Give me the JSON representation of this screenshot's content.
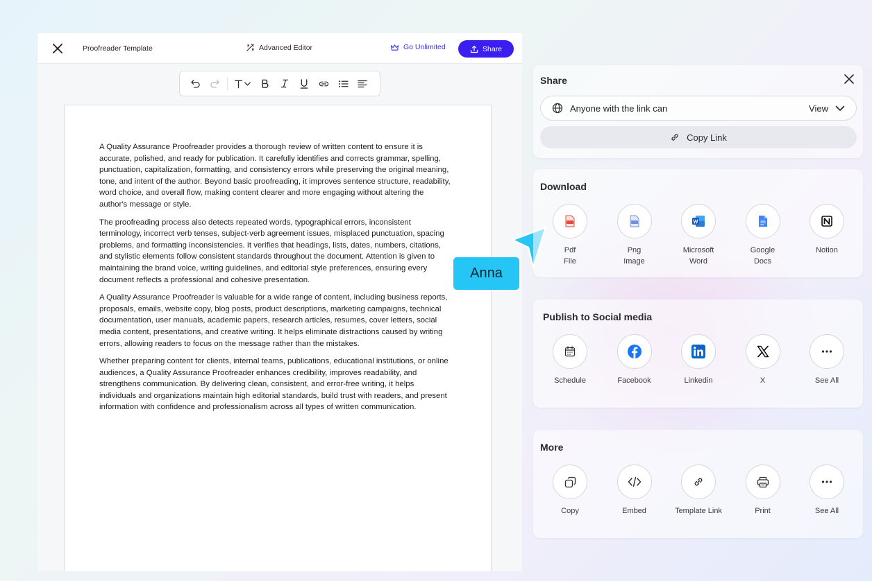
{
  "editor": {
    "title": "Proofreader Template",
    "advanced_editor_label": "Advanced Editor",
    "go_unlimited_label": "Go Unlimited",
    "share_label": "Share",
    "paragraphs": [
      "A Quality Assurance Proofreader provides a thorough review of written content to ensure it is accurate, polished, and ready for publication. It carefully identifies and corrects grammar, spelling, punctuation, capitalization, formatting, and consistency errors while preserving the original meaning, tone, and intent of the author. Beyond basic proofreading, it improves sentence structure, readability, word choice, and overall flow, making content clearer and more engaging without altering the author's message or style.",
      "The proofreading process also detects repeated words, typographical errors, inconsistent terminology, incorrect verb tenses, subject-verb agreement issues, misplaced punctuation, spacing problems, and formatting inconsistencies. It verifies that headings, lists, dates, numbers, citations, and stylistic elements follow consistent standards throughout the document. Attention is given to maintaining the brand voice, writing guidelines, and editorial style preferences, ensuring every document reflects a professional and cohesive presentation.",
      "A Quality Assurance Proofreader is valuable for a wide range of content, including business reports, proposals, emails, website copy, blog posts, product descriptions, marketing campaigns, technical documentation, user manuals, academic papers, research articles, resumes, cover letters, social media content, presentations, and creative writing. It helps eliminate distractions caused by writing errors, allowing readers to focus on the message rather than the mistakes.",
      "Whether preparing content for clients, internal teams, publications, educational institutions, or online audiences, a Quality Assurance Proofreader enhances credibility, improves readability, and strengthens communication. By delivering clean, consistent, and error-free writing, it helps individuals and organizations maintain high editorial standards, build trust with readers, and present information with confidence and professionalism across all types of written communication."
    ]
  },
  "cursor": {
    "name": "Anna",
    "color": "#25c6f5"
  },
  "share_panel": {
    "title": "Share",
    "access_label": "Anyone with the link can",
    "access_value": "View",
    "copy_link_label": "Copy Link"
  },
  "download_panel": {
    "title": "Download",
    "items": [
      {
        "line1": "Pdf",
        "line2": "File",
        "icon": "pdf-file-icon"
      },
      {
        "line1": "Png",
        "line2": "Image",
        "icon": "png-image-icon"
      },
      {
        "line1": "Microsoft",
        "line2": "Word",
        "icon": "microsoft-word-icon"
      },
      {
        "line1": "Google",
        "line2": "Docs",
        "icon": "google-docs-icon"
      },
      {
        "line1": "Notion",
        "line2": "",
        "icon": "notion-icon"
      }
    ]
  },
  "social_panel": {
    "title": "Publish to Social media",
    "items": [
      {
        "label": "Schedule",
        "icon": "calendar-icon"
      },
      {
        "label": "Facebook",
        "icon": "facebook-icon"
      },
      {
        "label": "Linkedin",
        "icon": "linkedin-icon"
      },
      {
        "label": "X",
        "icon": "x-icon"
      },
      {
        "label": "See All",
        "icon": "more-dots-icon"
      }
    ]
  },
  "more_panel": {
    "title": "More",
    "items": [
      {
        "label": "Copy",
        "icon": "copy-icon"
      },
      {
        "label": "Embed",
        "icon": "code-icon"
      },
      {
        "label": "Template Link",
        "icon": "link-icon"
      },
      {
        "label": "Print",
        "icon": "printer-icon"
      },
      {
        "label": "See All",
        "icon": "more-dots-icon"
      }
    ]
  },
  "colors": {
    "primary": "#3b1ff0",
    "facebook": "#1877f2",
    "linkedin": "#0a66c2",
    "word": "#185abd",
    "google_docs": "#4285f4",
    "pdf": "#e24a3b"
  }
}
